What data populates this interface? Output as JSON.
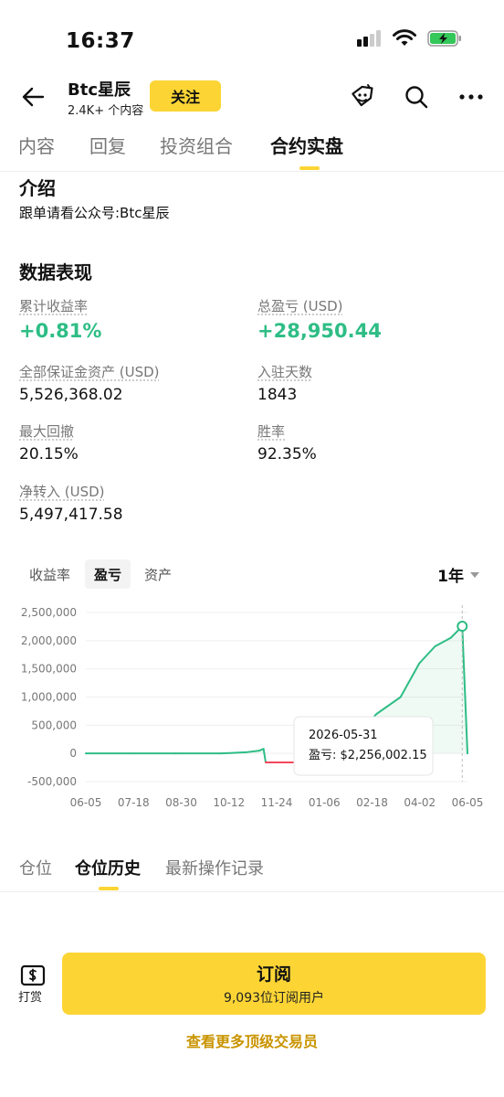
{
  "status": {
    "time": "16:37"
  },
  "header": {
    "name": "Btc星辰",
    "subtitle": "2.4K+ 个内容",
    "follow_label": "关注"
  },
  "tabs": [
    {
      "label": "内容"
    },
    {
      "label": "回复"
    },
    {
      "label": "投资组合"
    },
    {
      "label": "合约实盘"
    }
  ],
  "intro": {
    "title": "介绍",
    "text": "跟单请看公众号:Btc星辰"
  },
  "performance": {
    "title": "数据表现",
    "cumulative_return_label": "累计收益率",
    "cumulative_return": "+0.81%",
    "total_pnl_label": "总盈亏 (USD)",
    "total_pnl": "+28,950.44",
    "margin_assets_label": "全部保证金资产 (USD)",
    "margin_assets": "5,526,368.02",
    "days_label": "入驻天数",
    "days": "1843",
    "max_drawdown_label": "最大回撤",
    "max_drawdown": "20.15%",
    "win_rate_label": "胜率",
    "win_rate": "92.35%",
    "net_transfer_label": "净转入 (USD)",
    "net_transfer": "5,497,417.58"
  },
  "chart_tabs": [
    {
      "label": "收益率"
    },
    {
      "label": "盈亏"
    },
    {
      "label": "资产"
    }
  ],
  "range": "1年",
  "chart_data": {
    "type": "line",
    "y_ticks": [
      "2,500,000",
      "2,000,000",
      "1,500,000",
      "1,000,000",
      "500,000",
      "0",
      "-500,000"
    ],
    "x_ticks": [
      "06-05",
      "07-18",
      "08-30",
      "10-12",
      "11-24",
      "01-06",
      "02-18",
      "04-02",
      "06-05"
    ],
    "ylim": [
      -500000,
      2500000
    ],
    "grid": true,
    "positive_color": "#2EBD85",
    "negative_color": "#F6465D",
    "points": [
      [
        "06-05",
        0
      ],
      [
        "07-18",
        0
      ],
      [
        "08-30",
        0
      ],
      [
        "10-12",
        0
      ],
      [
        "11-05",
        20000
      ],
      [
        "11-18",
        50000
      ],
      [
        "11-22",
        80000
      ],
      [
        "11-24",
        -160000
      ],
      [
        "01-06",
        -160000
      ],
      [
        "02-10",
        -150000
      ],
      [
        "02-18",
        300000
      ],
      [
        "03-10",
        700000
      ],
      [
        "04-02",
        1000000
      ],
      [
        "04-20",
        1600000
      ],
      [
        "05-05",
        1900000
      ],
      [
        "05-20",
        2050000
      ],
      [
        "05-31",
        2256002.15
      ],
      [
        "06-05",
        0
      ]
    ],
    "tooltip": {
      "date": "2026-05-31",
      "text": "盈亏: $2,256,002.15"
    }
  },
  "position_tabs": [
    {
      "label": "仓位"
    },
    {
      "label": "仓位历史"
    },
    {
      "label": "最新操作记录"
    }
  ],
  "footer": {
    "tip_label": "打赏",
    "subscribe_label": "订阅",
    "subscribers": "9,093位订阅用户",
    "more_link": "查看更多顶级交易员"
  }
}
